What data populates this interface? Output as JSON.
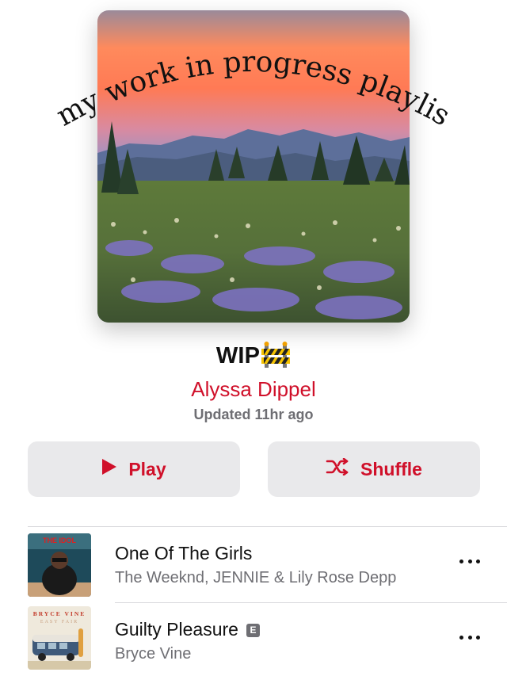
{
  "artwork": {
    "overlay_text": "my work in progress playlist"
  },
  "playlist": {
    "title": "WIP",
    "title_icon": "construction-barrier-icon",
    "curator": "Alyssa Dippel",
    "updated": "Updated 11hr ago"
  },
  "actions": {
    "play_label": "Play",
    "shuffle_label": "Shuffle",
    "accent_color": "#d0102a"
  },
  "tracks": [
    {
      "title": "One Of The Girls",
      "artist": "The Weeknd, JENNIE & Lily Rose Depp",
      "explicit": false,
      "artwork_text": "THE IDOL"
    },
    {
      "title": "Guilty Pleasure",
      "artist": "Bryce Vine",
      "explicit": true,
      "explicit_label": "E",
      "artwork_text": "BRYCE VINE",
      "artwork_subtext": "EASY FAIR"
    }
  ]
}
